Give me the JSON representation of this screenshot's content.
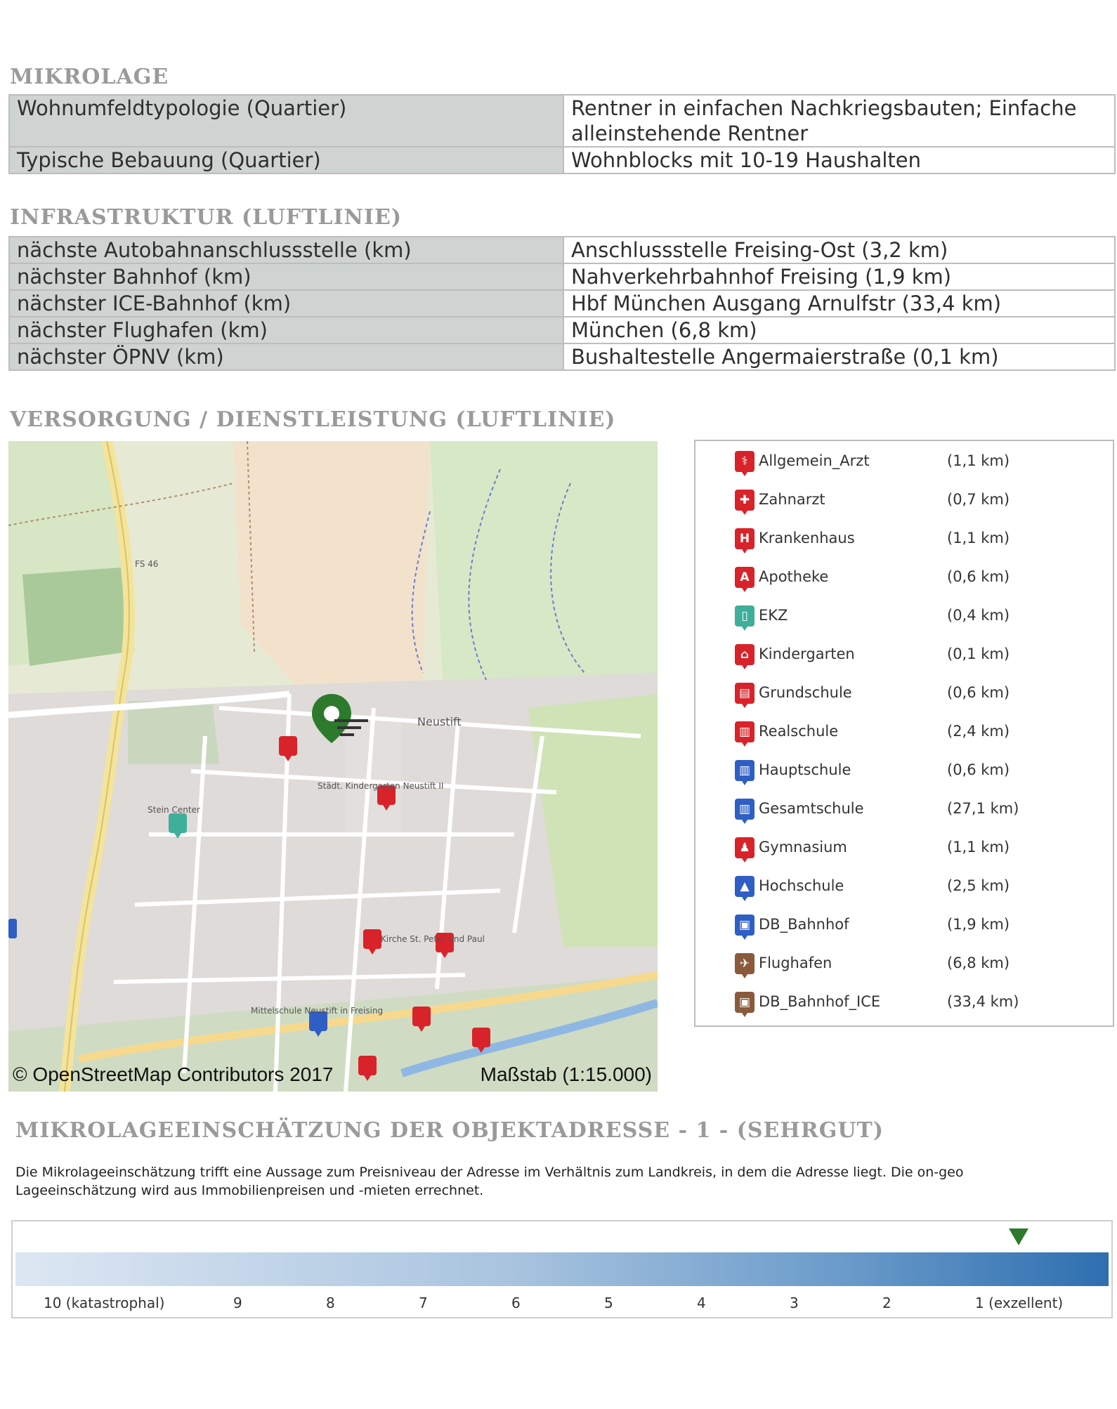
{
  "mikrolage": {
    "title": "MIKROLAGE",
    "rows": [
      {
        "key": "Wohnumfeldtypologie (Quartier)",
        "value": "Rentner in einfachen Nachkriegsbauten; Einfache alleinstehende Rentner"
      },
      {
        "key": "Typische Bebauung (Quartier)",
        "value": "Wohnblocks mit 10-19 Haushalten"
      }
    ]
  },
  "infrastruktur": {
    "title": "INFRASTRUKTUR (LUFTLINIE)",
    "rows": [
      {
        "key": "nächste Autobahnanschlussstelle (km)",
        "value": "Anschlussstelle Freising-Ost (3,2 km)"
      },
      {
        "key": "nächster Bahnhof (km)",
        "value": "Nahverkehrbahnhof Freising (1,9 km)"
      },
      {
        "key": "nächster ICE-Bahnhof (km)",
        "value": "Hbf München Ausgang Arnulfstr (33,4 km)"
      },
      {
        "key": "nächster Flughafen (km)",
        "value": "München (6,8 km)"
      },
      {
        "key": "nächster ÖPNV (km)",
        "value": "Bushaltestelle Angermaierstraße (0,1 km)"
      }
    ]
  },
  "versorgung": {
    "title": "VERSORGUNG / DIENSTLEISTUNG (LUFTLINIE)",
    "map": {
      "attribution": "© OpenStreetMap Contributors 2017",
      "scale": "Maßstab (1:15.000)",
      "labels": {
        "neustift": "Neustift",
        "steincenter": "Stein Center",
        "fs46": "FS 46",
        "kita": "Städt. Kindergarten Neustift II",
        "kirche": "Kirche St. Peter und Paul",
        "mittelschule": "Mittelschule Neustift in Freising"
      }
    },
    "legend": [
      {
        "name": "Allgemein_Arzt",
        "distance": "(1,1 km)",
        "color": "#d8232a",
        "glyph": "⚕",
        "icon": "doctor-icon"
      },
      {
        "name": "Zahnarzt",
        "distance": "(0,7 km)",
        "color": "#d8232a",
        "glyph": "✚",
        "icon": "tooth-icon"
      },
      {
        "name": "Krankenhaus",
        "distance": "(1,1 km)",
        "color": "#d8232a",
        "glyph": "H",
        "icon": "hospital-icon"
      },
      {
        "name": "Apotheke",
        "distance": "(0,6 km)",
        "color": "#d8232a",
        "glyph": "A",
        "icon": "pharmacy-icon"
      },
      {
        "name": "EKZ",
        "distance": "(0,4 km)",
        "color": "#3fae9a",
        "glyph": "▯",
        "icon": "shopping-icon"
      },
      {
        "name": "Kindergarten",
        "distance": "(0,1 km)",
        "color": "#d8232a",
        "glyph": "⌂",
        "icon": "kindergarten-icon"
      },
      {
        "name": "Grundschule",
        "distance": "(0,6 km)",
        "color": "#d8232a",
        "glyph": "▤",
        "icon": "primary-school-icon"
      },
      {
        "name": "Realschule",
        "distance": "(2,4 km)",
        "color": "#d8232a",
        "glyph": "▥",
        "icon": "secondary-school-icon"
      },
      {
        "name": "Hauptschule",
        "distance": "(0,6 km)",
        "color": "#2f5fc4",
        "glyph": "▥",
        "icon": "main-school-icon"
      },
      {
        "name": "Gesamtschule",
        "distance": "(27,1 km)",
        "color": "#2f5fc4",
        "glyph": "▥",
        "icon": "comprehensive-school-icon"
      },
      {
        "name": "Gymnasium",
        "distance": "(1,1 km)",
        "color": "#d8232a",
        "glyph": "♟",
        "icon": "gymnasium-icon"
      },
      {
        "name": "Hochschule",
        "distance": "(2,5 km)",
        "color": "#2f5fc4",
        "glyph": "▲",
        "icon": "university-icon"
      },
      {
        "name": "DB_Bahnhof",
        "distance": "(1,9 km)",
        "color": "#2f5fc4",
        "glyph": "▣",
        "icon": "train-icon"
      },
      {
        "name": "Flughafen",
        "distance": "(6,8 km)",
        "color": "#8a5a3c",
        "glyph": "✈",
        "icon": "airport-icon"
      },
      {
        "name": "DB_Bahnhof_ICE",
        "distance": "(33,4 km)",
        "color": "#8a5a3c",
        "glyph": "▣",
        "icon": "ice-train-icon"
      }
    ]
  },
  "einschaetzung": {
    "title": "MIKROLAGEEINSCHÄTZUNG DER OBJEKTADRESSE - 1 - (SEHRGUT)",
    "description": "Die Mikrolageeinschätzung trifft eine Aussage zum Preisniveau der Adresse im Verhältnis zum Landkreis, in dem die Adresse liegt. Die on-geo Lageeinschätzung wird aus Immobilienpreisen und -mieten errechnet.",
    "scale_labels": [
      "10 (katastrophal)",
      "9",
      "8",
      "7",
      "6",
      "5",
      "4",
      "3",
      "2",
      "1 (exzellent)"
    ],
    "marker_value": 1,
    "marker_color": "#2d7a2d"
  }
}
